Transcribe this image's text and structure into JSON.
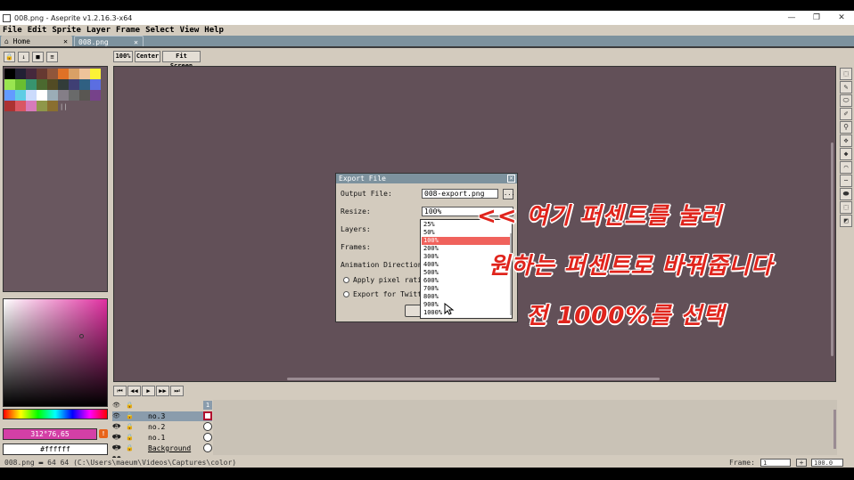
{
  "window": {
    "title": "008.png - Aseprite v1.2.16.3-x64",
    "minimize": "—",
    "restore": "❐",
    "close": "✕"
  },
  "menu": [
    "File",
    "Edit",
    "Sprite",
    "Layer",
    "Frame",
    "Select",
    "View",
    "Help"
  ],
  "tabs": {
    "home": "⌂ Home",
    "home_close": "✕",
    "active": "008.png",
    "active_close": "✕"
  },
  "palette_toolbar": [
    "🔒",
    "↓",
    "■",
    "≡"
  ],
  "palette": {
    "colors": [
      "#000000",
      "#222034",
      "#45283c",
      "#663931",
      "#8f563b",
      "#df7126",
      "#d9a066",
      "#eec39a",
      "#fbf236",
      "#99e550",
      "#6abe30",
      "#37946e",
      "#4b692f",
      "#524b24",
      "#323c39",
      "#3f3f74",
      "#306082",
      "#5b6ee1",
      "#639bff",
      "#5fcde4",
      "#cbdbfc",
      "#ffffff",
      "#9badb7",
      "#847e87",
      "#696a6a",
      "#595652",
      "#76428a",
      "#ac3232",
      "#d95763",
      "#d77bba",
      "#8f974a",
      "#8a6f30"
    ],
    "selection_count": "||"
  },
  "colors": {
    "foreground_label": "312°76,65",
    "foreground_hex": "#d43fa6",
    "warning_icon": "!",
    "background_label": "#ffffff"
  },
  "zoom_buttons": {
    "zoom100": "100%",
    "center": "Center",
    "fit": "Fit Screen"
  },
  "tools": [
    "⬚",
    "✎",
    "⬭",
    "✐",
    "⚲",
    "✥",
    "◆",
    "⌒",
    "∽",
    "⬬",
    "⬚",
    "◩"
  ],
  "timeline": {
    "controls": [
      "⏮",
      "◀◀",
      "▶",
      "▶▶",
      "⏭"
    ],
    "header_icons": "👁 🔒 ●● ⛓ ▣",
    "frame_number": "1",
    "layers": [
      {
        "icons": "👁 🔒 ◆◆",
        "name": "no.3",
        "selected": true
      },
      {
        "icons": "👁 🔒 ●●",
        "name": "no.2",
        "selected": false
      },
      {
        "icons": "👁 🔒 ●●",
        "name": "no.1",
        "selected": false
      },
      {
        "icons": "👁 🔒 ●●",
        "name": "Background",
        "selected": false
      }
    ]
  },
  "status": {
    "left": "008.png  ▬ 64 64  (C:\\Users\\maeum\\Videos\\Captures\\color)",
    "frame_label": "Frame:",
    "frame_value": "1",
    "plus": "+",
    "zoom": "100.0"
  },
  "dialog": {
    "title": "Export File",
    "close": "✕",
    "output_label": "Output File:",
    "output_value": "008-export.png",
    "browse": "...",
    "resize_label": "Resize:",
    "resize_value": "100%",
    "layers_label": "Layers:",
    "frames_label": "Frames:",
    "direction_label": "Animation Direction:",
    "pixel_ratio_label": "Apply pixel ratio",
    "twitter_label": "Export for Twitte"
  },
  "dropdown": {
    "options": [
      "25%",
      "50%",
      "100%",
      "200%",
      "300%",
      "400%",
      "500%",
      "600%",
      "700%",
      "800%",
      "900%",
      "1000%"
    ],
    "selected": "100%"
  },
  "annotations": [
    "<< 여기 퍼센트를 눌러",
    "원하는 퍼센트로 바꿔줍니다",
    "전 1000%를 선택"
  ]
}
